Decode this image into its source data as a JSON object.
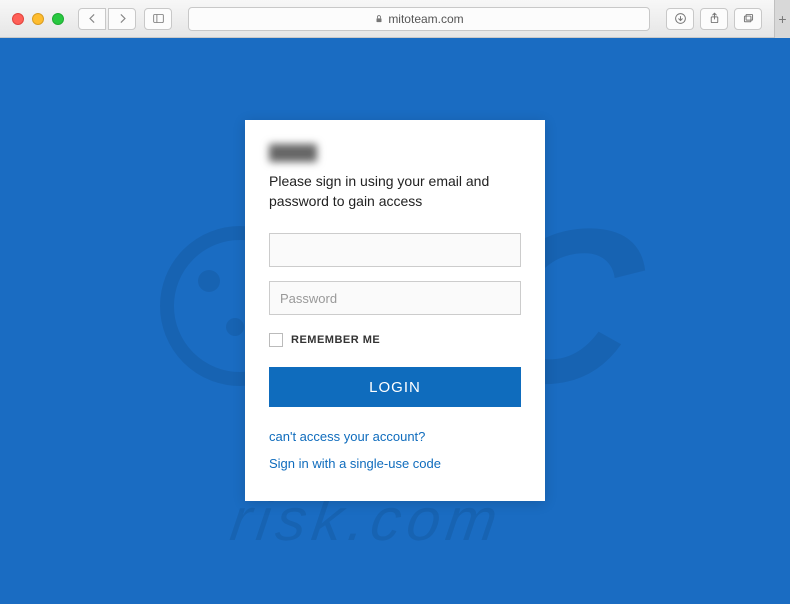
{
  "browser": {
    "url_display": "mitoteam.com",
    "lock_icon": "lock-icon"
  },
  "watermark": {
    "text": "PC",
    "subtext": "risk.com"
  },
  "login": {
    "subtitle": "Please sign in using your email and password to gain access",
    "email_value": "",
    "password_placeholder": "Password",
    "password_value": "",
    "remember_label": "REMEMBER ME",
    "submit_label": "LOGIN",
    "link_cant_access": "can't access your account?",
    "link_single_use": "Sign in with a single-use code"
  }
}
